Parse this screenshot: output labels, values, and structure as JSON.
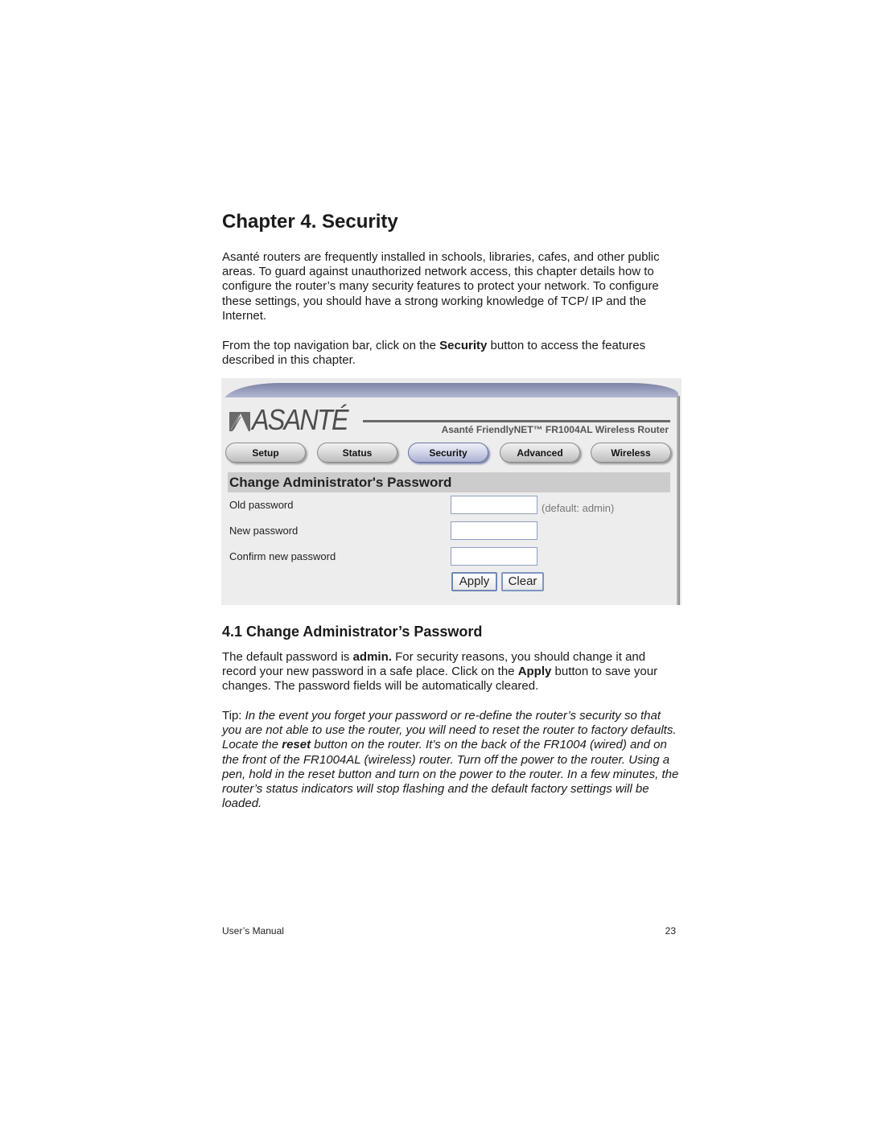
{
  "chapter_title": "Chapter 4. Security",
  "intro_paragraph": "Asanté routers are frequently installed in schools, libraries, cafes, and other public areas. To guard against unauthorized network access, this chapter details how to configure the router’s many security features to protect your network. To configure these settings, you should have a strong working knowledge of TCP/ IP and the Internet.",
  "nav_paragraph": {
    "before": "From the top navigation bar, click on the ",
    "bold": "Security",
    "after": " button to access the features described in this chapter."
  },
  "screenshot": {
    "logo_text": "ASANTÉ",
    "product_name": "Asanté FriendlyNET™  FR1004AL  Wireless Router",
    "nav_buttons": [
      {
        "label": "Setup",
        "active": false
      },
      {
        "label": "Status",
        "active": false
      },
      {
        "label": "Security",
        "active": true
      },
      {
        "label": "Advanced",
        "active": false
      },
      {
        "label": "Wireless",
        "active": false
      }
    ],
    "panel_title": "Change Administrator's Password",
    "fields": [
      {
        "label": "Old password",
        "value": ""
      },
      {
        "label": "New password",
        "value": ""
      },
      {
        "label": "Confirm new password",
        "value": ""
      }
    ],
    "old_password_hint": "(default: admin)",
    "apply_label": "Apply",
    "clear_label": "Clear"
  },
  "section_title": "4.1 Change Administrator’s Password",
  "section_paragraph": {
    "p1": "The default password is ",
    "b1": "admin.",
    "p2": " For security reasons, you should change it and record your new password in a safe place.  Click on the ",
    "b2": "Apply",
    "p3": " button to save your changes. The password fields will be automatically cleared."
  },
  "tip": {
    "label": "Tip",
    "colon": ": ",
    "i1": "In the event you forget your password or re-define the router’s security so that you are not able to use the router, you will need to reset the router to factory defaults. Locate the ",
    "b1": "reset",
    "i2": " button on the router. It’s on the back of the FR1004 (wired) and on the front of the FR1004AL (wireless) router. Turn off the power to the router. Using a pen, hold in the reset button and turn on the power to the router. In a few minutes, the router’s status indicators will stop flashing and the default factory settings will be loaded."
  },
  "footer": {
    "left": "User’s Manual",
    "page_number": "23"
  }
}
